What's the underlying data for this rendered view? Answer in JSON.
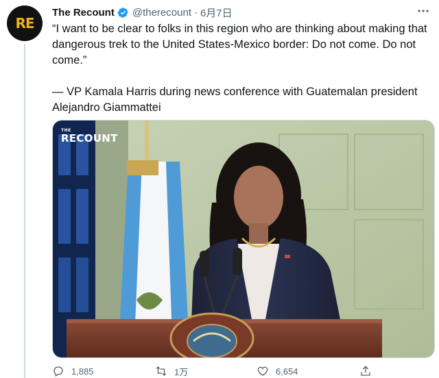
{
  "account": {
    "avatar_text": "RE",
    "display_name": "The Recount",
    "handle": "@therecount",
    "separator": "·",
    "date": "6月7日"
  },
  "tweet": {
    "text": "“I want to be clear to folks in this region who are thinking about making that dangerous trek to the United States-Mexico border: Do not come. Do not come.”\n\n— VP Kamala Harris during news conference with Guatemalan president Alejandro Giammattei"
  },
  "media": {
    "watermark_small": "THE",
    "watermark_big": "RECOUNT"
  },
  "actions": {
    "reply_count": "1,885",
    "retweet_count": "1万",
    "like_count": "6,654"
  },
  "colors": {
    "verified": "#1d9bf0",
    "avatar_bg": "#111111",
    "avatar_text": "#f3b21b",
    "secondary_text": "#536471"
  },
  "icons": [
    "verified-icon",
    "more-icon",
    "reply-icon",
    "retweet-icon",
    "like-icon",
    "share-icon"
  ]
}
